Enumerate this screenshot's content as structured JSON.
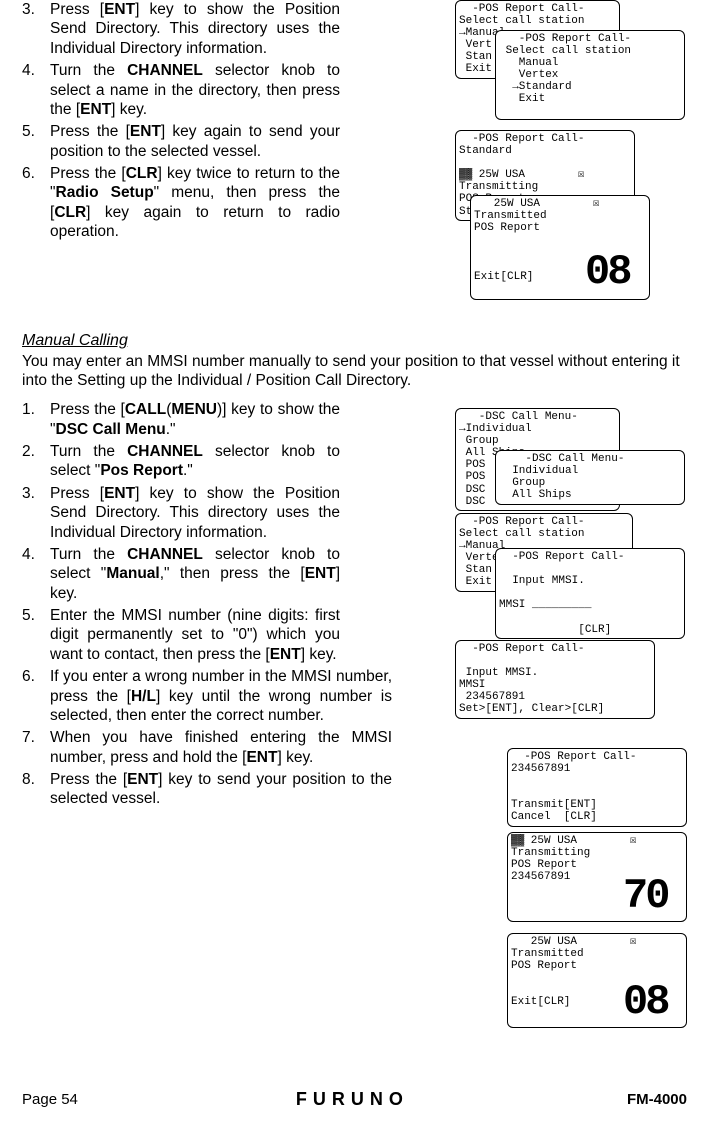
{
  "top_steps": {
    "s3": {
      "num": "3.",
      "text": "Press [",
      "k1": "ENT",
      "text2": "] key to show the Position Send Directory. This directory uses the Individual Directory information."
    },
    "s4": {
      "num": "4.",
      "text": "Turn the ",
      "k1": "CHANNEL",
      "text2": " selector knob to select a name in the directory, then press the [",
      "k2": "ENT",
      "text3": "] key."
    },
    "s5": {
      "num": "5.",
      "text": "Press the [",
      "k1": "ENT",
      "text2": "] key again to send your position to the selected vessel."
    },
    "s6": {
      "num": "6.",
      "text": "Press the [",
      "k1": "CLR",
      "text2": "] key twice to return to the \"",
      "code1": "Radio Setup",
      "text3": "\" menu, then press the [",
      "k2": "CLR",
      "text4": "] key again to return to radio operation."
    }
  },
  "heading": "Manual Calling",
  "intro": "You may enter an MMSI number manually to send your position to that vessel without entering it into the Setting up the Individual / Position Call Directory.",
  "manual_steps": {
    "s1": {
      "num": "1.",
      "text": "Press the [",
      "k1": "CALL",
      "paren": "(",
      "k2": "MENU",
      "paren2": ")",
      "text2": "] key to show the \"",
      "code1": "DSC Call Menu",
      "text3": ".\""
    },
    "s2": {
      "num": "2.",
      "text": "Turn the ",
      "k1": "CHANNEL",
      "text2": " selector knob to select \"",
      "code1": "Pos Report",
      "text3": ".\""
    },
    "s3": {
      "num": "3.",
      "text": "Press [",
      "k1": "ENT",
      "text2": "] key to show the Position Send Directory. This directory uses the Individual Directory information."
    },
    "s4": {
      "num": "4.",
      "text": "Turn the ",
      "k1": "CHANNEL",
      "text2": " selector knob to select \"",
      "code1": "Manual",
      "text3": ",\" then press the [",
      "k2": "ENT",
      "text4": "] key."
    },
    "s5": {
      "num": "5.",
      "text": "Enter the MMSI number (nine digits: first digit permanently set to \"0\") which you want to contact, then press the [",
      "k1": "ENT",
      "text2": "] key."
    },
    "s6": {
      "num": "6.",
      "text": "If you enter a wrong number in the MMSI number, press the [",
      "k1": "H/L",
      "text2": "] key until the wrong number is selected, then enter the correct number."
    },
    "s7": {
      "num": "7.",
      "text": "When you have finished entering the MMSI number, press and hold the [",
      "k1": "ENT",
      "text2": "] key."
    },
    "s8": {
      "num": "8.",
      "text": "Press the [",
      "k1": "ENT",
      "text2": "] key to send your position to the selected vessel."
    }
  },
  "footer": {
    "page": "Page 54",
    "brand": "FURUNO",
    "model": "FM-4000"
  },
  "screens": {
    "top1": "  -POS Report Call-\nSelect call station\n→Manual\n Vert\n Stan\n Exit",
    "top2": "   -POS Report Call-\n Select call station\n   Manual\n   Vertex\n  →Standard\n   Exit",
    "top3": "  -POS Report Call-\nStandard\n\n▓▓ 25W USA        ☒\nTransmitting\nPOS Report\nStandard",
    "top4": "   25W USA        ☒\nTransmitted\nPOS Report\n\n\n\nExit[CLR]",
    "big08a": "08",
    "mid1": "   -DSC Call Menu-\n→Individual\n Group\n All Ships\n POS\n POS\n DSC\n DSC",
    "mid2": "    -DSC Call Menu-\n  Individual\n  Group\n  All Ships",
    "mid3": "  -POS Report Call-\nSelect call station\n→Manual\n Vertex\n Stan\n Exit",
    "mid4": "  -POS Report Call-\n\n  Input MMSI.\n\nMMSI _________\n\n            [CLR]",
    "mid5": "  -POS Report Call-\n\n Input MMSI.\nMMSI\n 234567891\nSet>[ENT], Clear>[CLR]",
    "bot1": "  -POS Report Call-\n234567891\n\n\nTransmit[ENT]\nCancel  [CLR]",
    "bot2": "▓▓ 25W USA        ☒\nTransmitting\nPOS Report\n234567891",
    "bot3": "   25W USA        ☒\nTransmitted\nPOS Report\n\n\nExit[CLR]",
    "big70": "70",
    "big08b": "08"
  }
}
